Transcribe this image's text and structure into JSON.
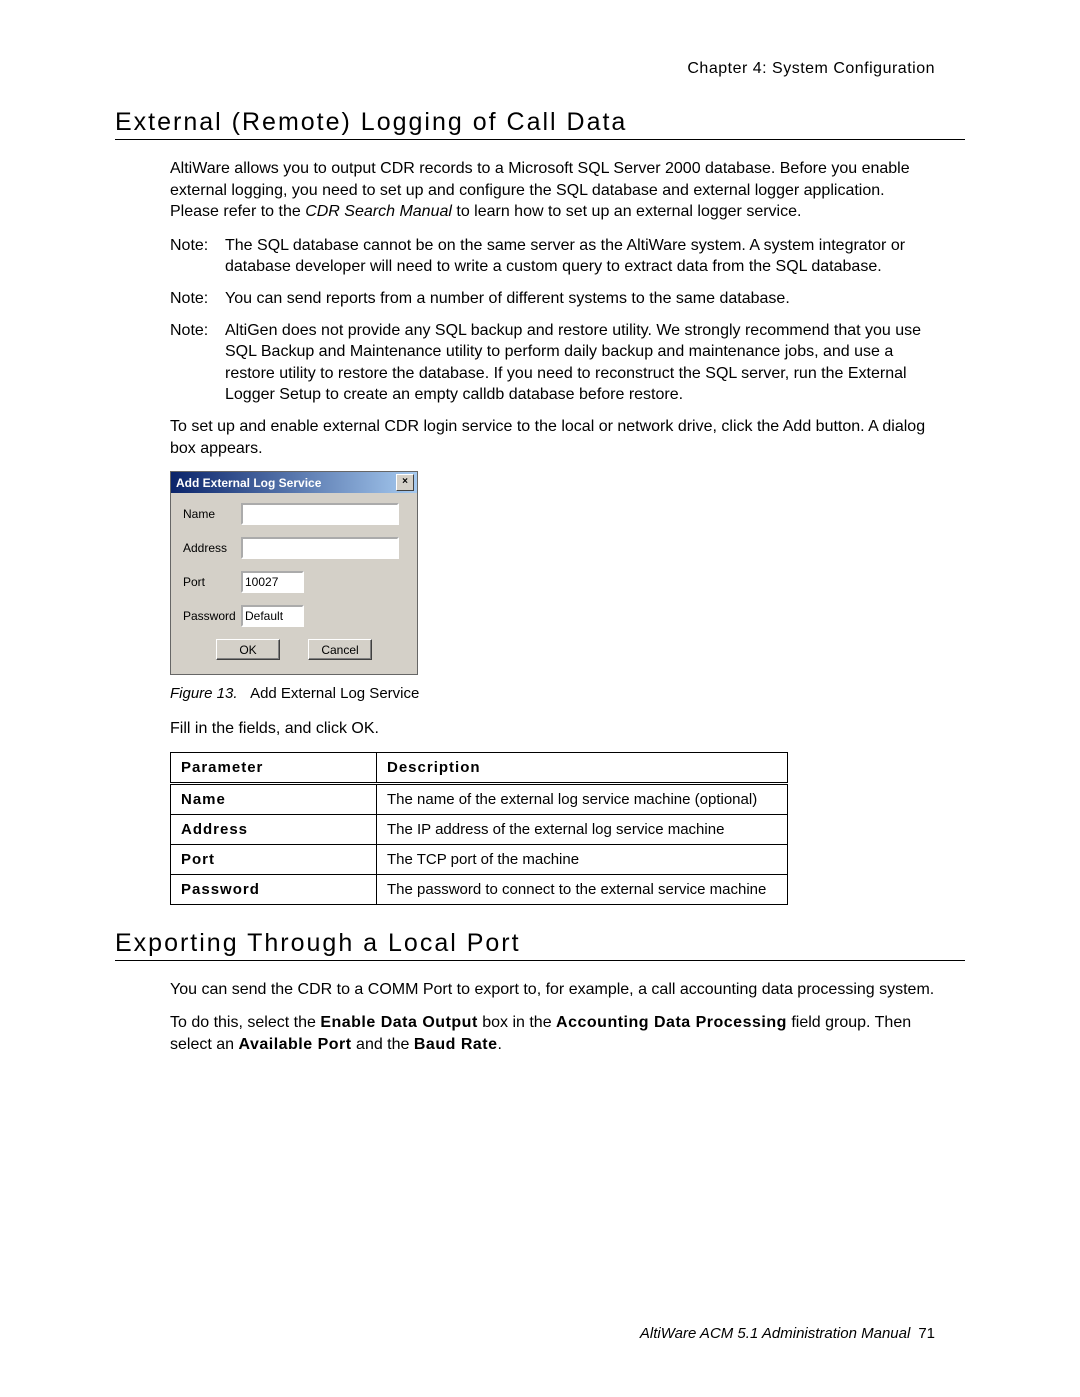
{
  "header": {
    "chapter": "Chapter 4:  System Configuration"
  },
  "section1": {
    "title": "External (Remote) Logging of Call Data",
    "intro_before_ital": "AltiWare allows you to output CDR records to a Microsoft SQL Server 2000 database. Before you enable external logging, you need to set up and configure the SQL database and external logger application. Please refer to the ",
    "intro_ital": "CDR Search Manual",
    "intro_after_ital": " to learn how to set up an external logger service.",
    "notes": [
      {
        "label": "Note:",
        "text": "The SQL database cannot be on the same server as the AltiWare system. A system integrator or database developer will need to write a custom query to extract data from the SQL database."
      },
      {
        "label": "Note:",
        "text": "You can send reports from a number of different systems to the same database."
      },
      {
        "label": "Note:",
        "text": "AltiGen does not provide any SQL backup and restore utility. We strongly recommend that you use SQL Backup and Maintenance utility to perform daily backup and maintenance jobs, and use a restore utility to restore the database. If you need to reconstruct the SQL server, run the External Logger Setup to create an empty calldb database before restore."
      }
    ],
    "setup_text": "To set up and enable external CDR login service to the local or network drive, click the Add button. A dialog box appears.",
    "figure": {
      "label": "Figure 13.",
      "caption": "Add External Log Service"
    },
    "fill_text": "Fill in the fields, and click OK."
  },
  "dialog": {
    "title": "Add External Log Service",
    "close": "×",
    "rows": {
      "name": {
        "label": "Name",
        "value": ""
      },
      "address": {
        "label": "Address",
        "value": ""
      },
      "port": {
        "label": "Port",
        "value": "10027"
      },
      "password": {
        "label": "Password",
        "value": "Default"
      }
    },
    "ok": "OK",
    "cancel": "Cancel"
  },
  "param_table": {
    "headers": {
      "param": "Parameter",
      "desc": "Description"
    },
    "rows": [
      {
        "param": "Name",
        "desc": "The name of the external log service machine (optional)"
      },
      {
        "param": "Address",
        "desc": "The IP address of the external log service machine"
      },
      {
        "param": "Port",
        "desc": "The TCP port of the machine"
      },
      {
        "param": "Password",
        "desc": "The password to connect to the external service machine"
      }
    ]
  },
  "section2": {
    "title": "Exporting Through a Local Port",
    "p1": "You can send the CDR to a COMM Port to export to, for example, a call accounting data processing system.",
    "p2_a": "To do this, select the ",
    "p2_b": "Enable Data Output",
    "p2_c": " box in the ",
    "p2_d": "Accounting Data Processing",
    "p2_e": " field group. Then select an ",
    "p2_f": "Available Port",
    "p2_g": " and the ",
    "p2_h": "Baud Rate",
    "p2_i": "."
  },
  "footer": {
    "manual": "AltiWare ACM 5.1 Administration Manual",
    "page": "71"
  }
}
